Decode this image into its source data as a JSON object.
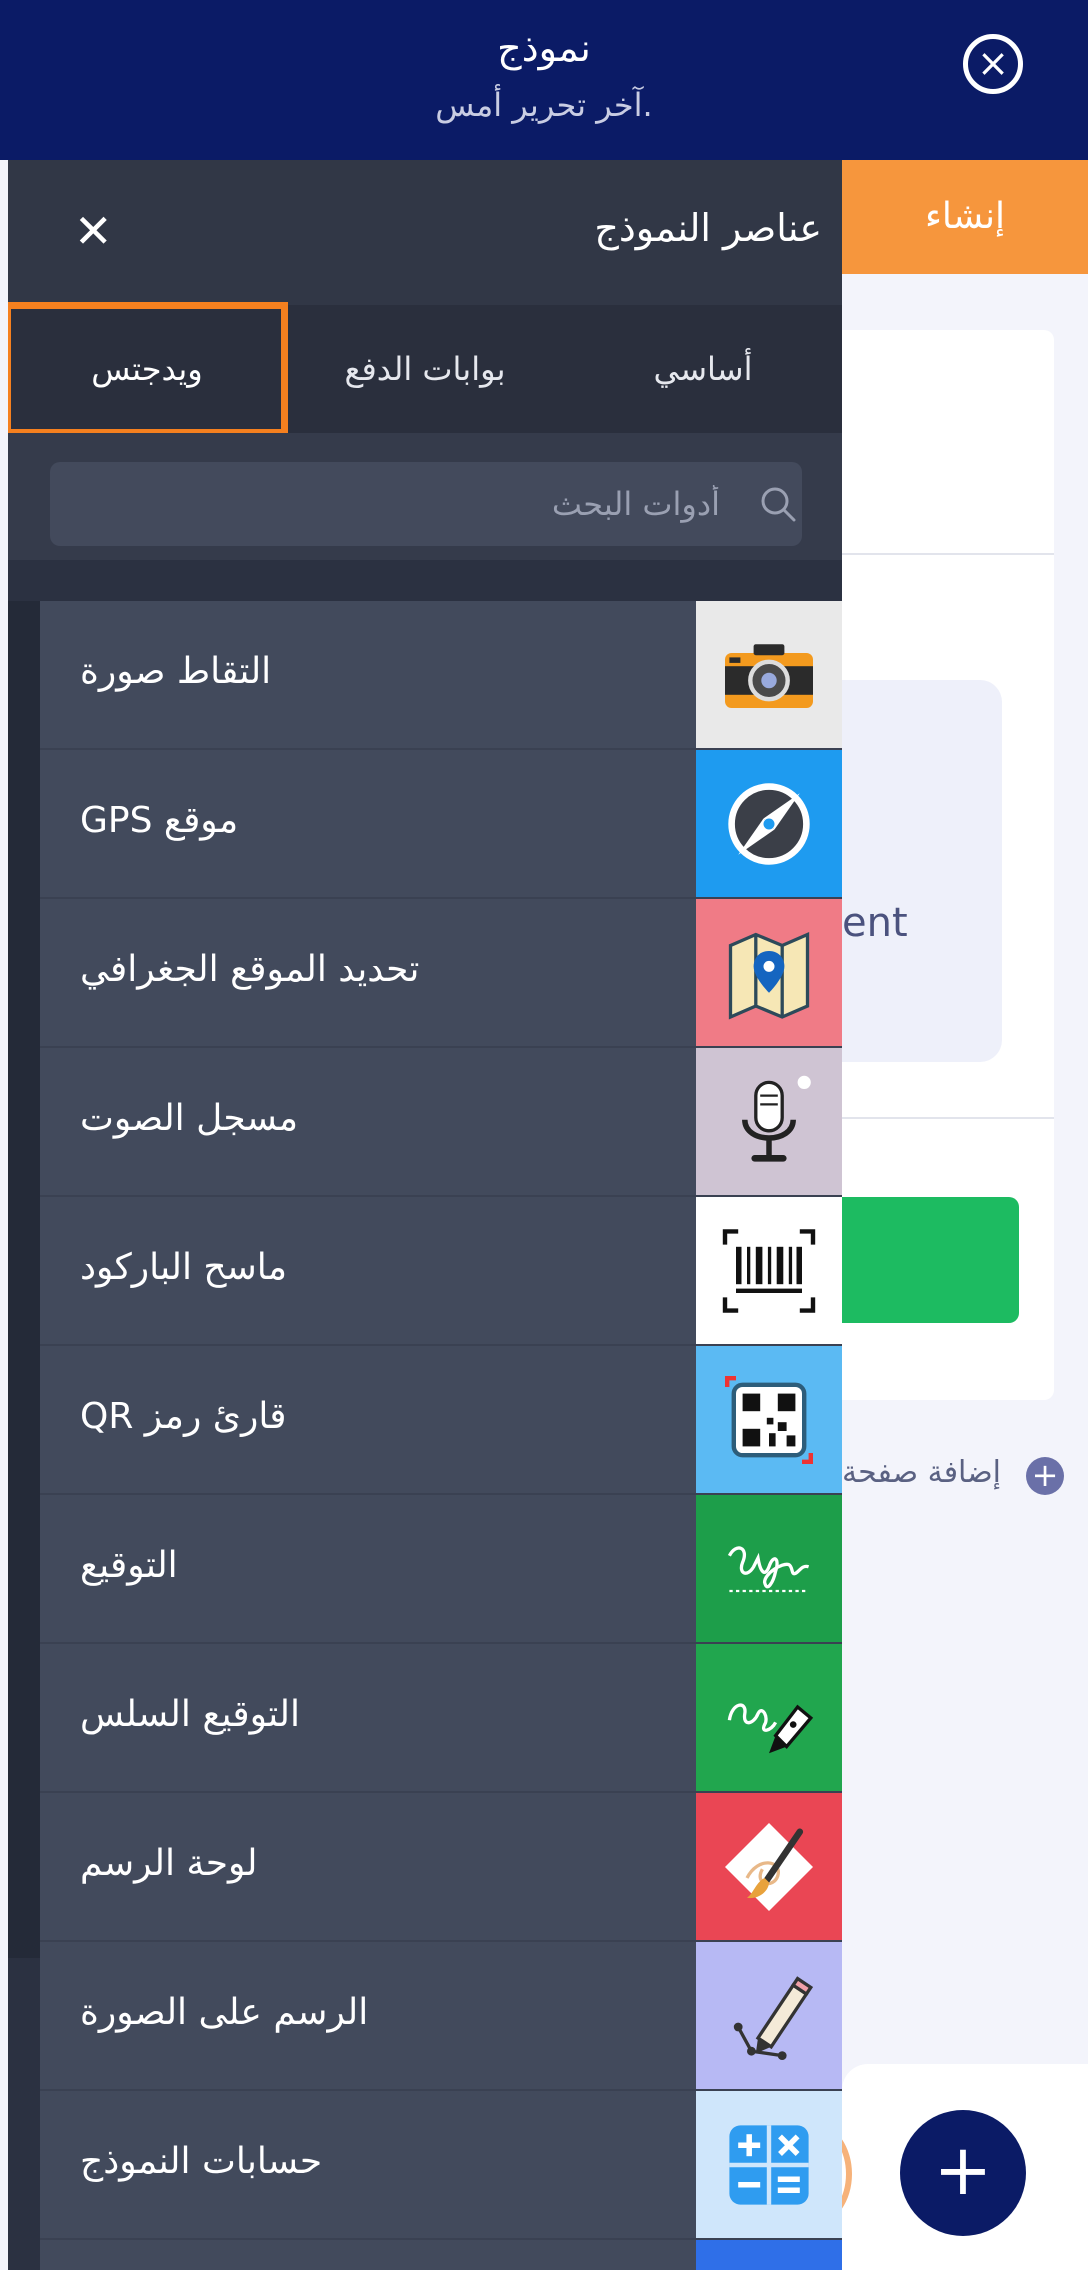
{
  "header": {
    "title": "نموذج",
    "subtitle": "آخر تحرير أمس."
  },
  "builder": {
    "create_tab": "إنشاء",
    "partial_text": "ent",
    "add_page": "إضافة صفحة"
  },
  "drawer": {
    "title": "عناصر النموذج",
    "tabs": [
      {
        "label": "أساسي"
      },
      {
        "label": "بوابات الدفع"
      },
      {
        "label": "ويدجتس"
      }
    ],
    "active_tab": "ويدجتس",
    "search": {
      "placeholder": "أدوات البحث",
      "value": ""
    },
    "items": [
      {
        "label": "التقاط صورة",
        "icon": "camera-icon",
        "color": "#e9e9e9"
      },
      {
        "label": "موقع GPS",
        "icon": "compass-icon",
        "color": "#1e9bf0"
      },
      {
        "label": "تحديد الموقع الجغرافي",
        "icon": "map-pin-icon",
        "color": "#f07b86"
      },
      {
        "label": "مسجل الصوت",
        "icon": "microphone-icon",
        "color": "#cfc4d3"
      },
      {
        "label": "ماسح الباركود",
        "icon": "barcode-icon",
        "color": "#ffffff"
      },
      {
        "label": "قارئ رمز QR",
        "icon": "qr-code-icon",
        "color": "#5bbaf3"
      },
      {
        "label": "التوقيع",
        "icon": "signature-icon",
        "color": "#1d9e4a"
      },
      {
        "label": "التوقيع السلس",
        "icon": "pen-nib-icon",
        "color": "#21a64e"
      },
      {
        "label": "لوحة الرسم",
        "icon": "paintbrush-icon",
        "color": "#ea4654"
      },
      {
        "label": "الرسم على الصورة",
        "icon": "pencil-icon",
        "color": "#b7b9f4"
      },
      {
        "label": "حسابات النموذج",
        "icon": "calculator-icon",
        "color": "#cfe6fb"
      }
    ]
  },
  "colors": {
    "header_bg": "#0b1b66",
    "accent_orange": "#f5801f",
    "drawer_bg": "#2b3141",
    "item_bg": "#424a5c"
  }
}
